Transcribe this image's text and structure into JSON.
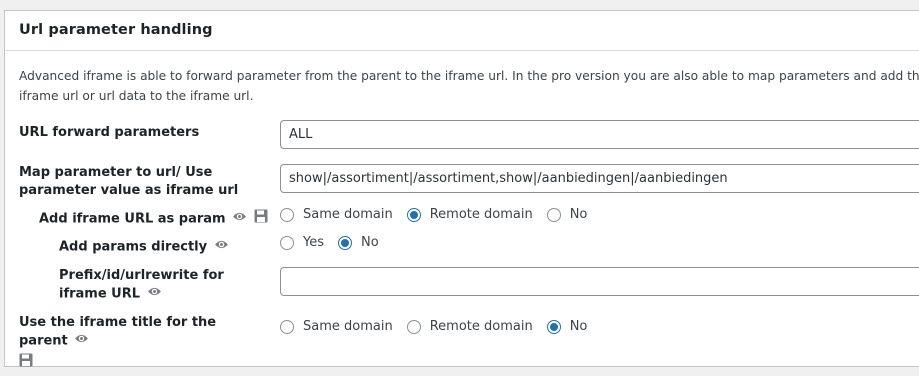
{
  "panel": {
    "title": "Url parameter handling",
    "description": "Advanced iframe is able to forward parameter from the parent to the iframe url. In the pro version you are also able to map parameters and add the iframe url or url data to the iframe url."
  },
  "fields": {
    "url_forward": {
      "label": "URL forward parameters",
      "value": "ALL"
    },
    "map_param": {
      "label": "Map parameter to url/ Use parameter value as iframe url",
      "value": "show|/assortiment|/assortiment,show|/aanbiedingen|/aanbiedingen"
    },
    "add_iframe_url": {
      "label": "Add iframe URL as param",
      "icons": [
        "eye-icon",
        "save-icon"
      ],
      "options": [
        "Same domain",
        "Remote domain",
        "No"
      ],
      "selected": "Remote domain"
    },
    "add_params_directly": {
      "label": "Add params directly",
      "icons": [
        "eye-icon"
      ],
      "options": [
        "Yes",
        "No"
      ],
      "selected": "No"
    },
    "prefix": {
      "label": "Prefix/id/urlrewrite for iframe URL",
      "icons": [
        "eye-icon"
      ],
      "value": ""
    },
    "iframe_title": {
      "label": "Use the iframe title for the parent",
      "icons": [
        "eye-icon",
        "save-icon"
      ],
      "options": [
        "Same domain",
        "Remote domain",
        "No"
      ],
      "selected": "No"
    }
  }
}
